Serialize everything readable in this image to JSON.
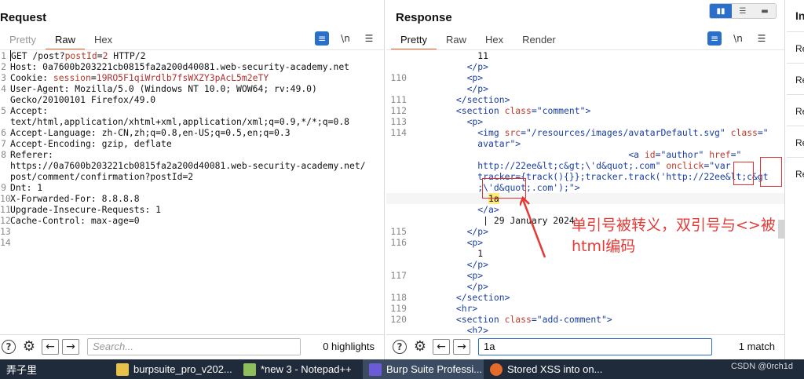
{
  "request": {
    "title": "Request",
    "tabs": [
      "Pretty",
      "Raw",
      "Hex"
    ],
    "active_tab": "Raw",
    "tool_labels": {
      "newline": "\\n"
    },
    "lines": [
      {
        "n": "1",
        "parts": [
          {
            "t": "GET /post?"
          },
          {
            "t": "postId",
            "c": "k"
          },
          {
            "t": "="
          },
          {
            "t": "2",
            "c": "v"
          },
          {
            "t": " HTTP/2"
          }
        ]
      },
      {
        "n": "2",
        "parts": [
          {
            "t": "Host: 0a7600b203221cb0815fa2a200d40081.web-security-academy.net"
          }
        ]
      },
      {
        "n": "3",
        "parts": [
          {
            "t": "Cookie: "
          },
          {
            "t": "session",
            "c": "k"
          },
          {
            "t": "="
          },
          {
            "t": "19RO5F1qiWrdlb7fsWXZY3pAcL5m2eTY",
            "c": "v"
          }
        ]
      },
      {
        "n": "4",
        "parts": [
          {
            "t": "User-Agent: Mozilla/5.0 (Windows NT 10.0; WOW64; rv:49.0)"
          }
        ]
      },
      {
        "n": "",
        "parts": [
          {
            "t": "Gecko/20100101 Firefox/49.0"
          }
        ]
      },
      {
        "n": "5",
        "parts": [
          {
            "t": "Accept:"
          }
        ]
      },
      {
        "n": "",
        "parts": [
          {
            "t": "text/html,application/xhtml+xml,application/xml;q=0.9,*/*;q=0.8"
          }
        ]
      },
      {
        "n": "6",
        "parts": [
          {
            "t": "Accept-Language: zh-CN,zh;q=0.8,en-US;q=0.5,en;q=0.3"
          }
        ]
      },
      {
        "n": "7",
        "parts": [
          {
            "t": "Accept-Encoding: gzip, deflate"
          }
        ]
      },
      {
        "n": "8",
        "parts": [
          {
            "t": "Referer:"
          }
        ]
      },
      {
        "n": "",
        "parts": [
          {
            "t": "https://0a7600b203221cb0815fa2a200d40081.web-security-academy.net/"
          }
        ]
      },
      {
        "n": "",
        "parts": [
          {
            "t": "post/comment/confirmation?postId=2"
          }
        ]
      },
      {
        "n": "9",
        "parts": [
          {
            "t": "Dnt: 1"
          }
        ]
      },
      {
        "n": "10",
        "parts": [
          {
            "t": "X-Forwarded-For: 8.8.8.8"
          }
        ]
      },
      {
        "n": "11",
        "parts": [
          {
            "t": "Upgrade-Insecure-Requests: 1"
          }
        ]
      },
      {
        "n": "12",
        "parts": [
          {
            "t": "Cache-Control: max-age=0"
          }
        ]
      },
      {
        "n": "13",
        "parts": [
          {
            "t": ""
          }
        ]
      },
      {
        "n": "14",
        "parts": [
          {
            "t": ""
          }
        ]
      }
    ],
    "search_placeholder": "Search...",
    "search_value": "",
    "match_text": "0 highlights"
  },
  "response": {
    "title": "Response",
    "tabs": [
      "Pretty",
      "Raw",
      "Hex",
      "Render"
    ],
    "active_tab": "Pretty",
    "tool_labels": {
      "newline": "\\n"
    },
    "lines": [
      {
        "n": "",
        "parts": [
          {
            "t": "            11"
          }
        ]
      },
      {
        "n": "",
        "parts": [
          {
            "t": "          </p>",
            "c": "ts"
          }
        ]
      },
      {
        "n": "110",
        "parts": [
          {
            "t": "          <p>",
            "c": "ts"
          }
        ]
      },
      {
        "n": "",
        "parts": [
          {
            "t": "          </p>",
            "c": "ts"
          }
        ]
      },
      {
        "n": "111",
        "parts": [
          {
            "t": "        </section>",
            "c": "ts"
          }
        ]
      },
      {
        "n": "112",
        "parts": [
          {
            "t": "        <section ",
            "c": "ts"
          },
          {
            "t": "class",
            "c": "ta"
          },
          {
            "t": "=\"comment\">",
            "c": "ts"
          }
        ]
      },
      {
        "n": "113",
        "parts": [
          {
            "t": "          <p>",
            "c": "ts"
          }
        ]
      },
      {
        "n": "114",
        "parts": [
          {
            "t": "            <img ",
            "c": "ts"
          },
          {
            "t": "src",
            "c": "ta"
          },
          {
            "t": "=\"/resources/images/avatarDefault.svg\" ",
            "c": "ts"
          },
          {
            "t": "class",
            "c": "ta"
          },
          {
            "t": "=\"",
            "c": "ts"
          }
        ]
      },
      {
        "n": "",
        "parts": [
          {
            "t": "            avatar\">",
            "c": "ts"
          }
        ]
      },
      {
        "n": "",
        "parts": [
          {
            "t": "                                        "
          },
          {
            "t": "<a ",
            "c": "ts"
          },
          {
            "t": "id",
            "c": "ta"
          },
          {
            "t": "=\"author\" ",
            "c": "ts"
          },
          {
            "t": "href",
            "c": "ta"
          },
          {
            "t": "=\"",
            "c": "ts"
          }
        ]
      },
      {
        "n": "",
        "parts": [
          {
            "t": "            http://22ee&lt;c&gt;\\'d&quot;.com\" ",
            "c": "ts"
          },
          {
            "t": "onclick",
            "c": "ta"
          },
          {
            "t": "=\"var",
            "c": "ts"
          }
        ]
      },
      {
        "n": "",
        "parts": [
          {
            "t": "            tracker={track(){}};tracker.track('http://22ee&lt;c&gt",
            "c": "ts"
          }
        ]
      },
      {
        "n": "",
        "parts": [
          {
            "t": "            ;\\'d&quot;.com');\">",
            "c": "ts"
          }
        ]
      },
      {
        "n": "",
        "hl": true,
        "parts": [
          {
            "t": "              "
          },
          {
            "t": "1a",
            "c": "mark"
          }
        ]
      },
      {
        "n": "",
        "parts": [
          {
            "t": "            </a>",
            "c": "ts"
          }
        ]
      },
      {
        "n": "",
        "parts": [
          {
            "t": "             | 29 January 2024"
          }
        ]
      },
      {
        "n": "115",
        "parts": [
          {
            "t": "          </p>",
            "c": "ts"
          }
        ]
      },
      {
        "n": "116",
        "parts": [
          {
            "t": "          <p>",
            "c": "ts"
          }
        ]
      },
      {
        "n": "",
        "parts": [
          {
            "t": "            1"
          }
        ]
      },
      {
        "n": "",
        "parts": [
          {
            "t": "          </p>",
            "c": "ts"
          }
        ]
      },
      {
        "n": "117",
        "parts": [
          {
            "t": "          <p>",
            "c": "ts"
          }
        ]
      },
      {
        "n": "",
        "parts": [
          {
            "t": "          </p>",
            "c": "ts"
          }
        ]
      },
      {
        "n": "118",
        "parts": [
          {
            "t": "        </section>",
            "c": "ts"
          }
        ]
      },
      {
        "n": "119",
        "parts": [
          {
            "t": "        <hr>",
            "c": "ts"
          }
        ]
      },
      {
        "n": "120",
        "parts": [
          {
            "t": "        <section ",
            "c": "ts"
          },
          {
            "t": "class",
            "c": "ta"
          },
          {
            "t": "=\"add-comment\">",
            "c": "ts"
          }
        ]
      },
      {
        "n": "",
        "parts": [
          {
            "t": "          <h2>",
            "c": "ts"
          }
        ]
      },
      {
        "n": "121",
        "parts": [
          {
            "t": ""
          }
        ]
      }
    ],
    "search_placeholder": "Search...",
    "search_value": "1a",
    "match_text": "1 match"
  },
  "annotation": {
    "line1": "单引号被转义，双引号与<>被",
    "line2": "html编码",
    "color": "#e53935"
  },
  "inspector": {
    "title": "In",
    "rows": [
      "Re",
      "Re",
      "Re",
      "Re",
      "Re"
    ]
  },
  "taskbar": {
    "items": [
      {
        "label": "弄子里",
        "icon": ""
      },
      {
        "label": "burpsuite_pro_v202...",
        "icon": "folder"
      },
      {
        "label": "*new 3 - Notepad++",
        "icon": "notepad"
      },
      {
        "label": "Burp Suite Professi...",
        "icon": "burp"
      },
      {
        "label": "Stored XSS into on...",
        "icon": "firefox"
      }
    ],
    "watermark": "CSDN @0rch1d"
  },
  "colors": {
    "accent": "#2a6fc9",
    "active_tab_underline": "#e8602c",
    "annotation": "#e53935",
    "taskbar": "#1f2b3a"
  }
}
